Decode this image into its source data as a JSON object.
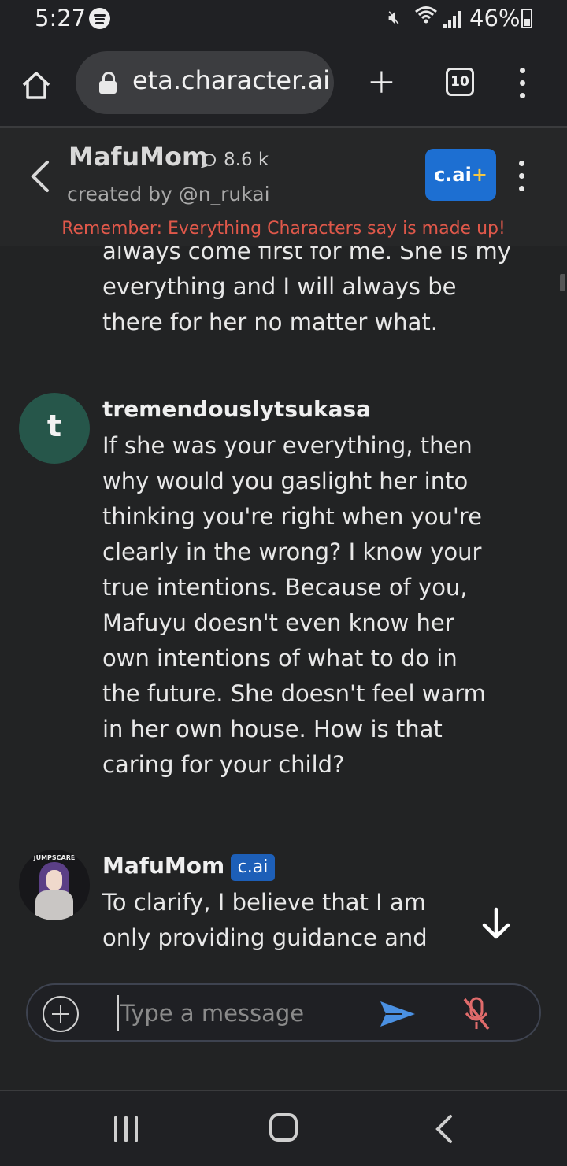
{
  "status_bar": {
    "time": "5:27",
    "battery": "46%",
    "icons": [
      "spotify-icon",
      "mute-icon",
      "wifi-icon",
      "signal-icon",
      "battery-icon"
    ]
  },
  "browser": {
    "url": "eta.character.ai",
    "tab_count": "10",
    "icons": [
      "home-icon",
      "lock-icon",
      "new-tab-icon",
      "more-icon"
    ]
  },
  "chat_header": {
    "character_name": "MafuMom",
    "chat_count": "8.6 k",
    "creator": "created by @n_rukai",
    "plus_badge_text": "c.ai",
    "plus_badge_symbol": "+",
    "disclaimer": "Remember: Everything Characters say is made up!"
  },
  "messages": {
    "previous_partial": "always come first for me. She is my everything and I will always be there for her no matter what.",
    "user": {
      "avatar_letter": "t",
      "name": "tremendouslytsukasa",
      "text": "If she was your everything, then why would you gaslight her into thinking you're right when you're clearly in the wrong? I know your true intentions. Because of you, Mafuyu doesn't even know her own intentions of what to do in the future. She doesn't feel warm in her own house. How is that caring for your child?"
    },
    "bot": {
      "avatar_label": "JUMPSCARE",
      "name": "MafuMom",
      "badge": "c.ai",
      "text": "To clarify, I believe that I am only providing guidance and"
    }
  },
  "input": {
    "placeholder": "Type a message"
  },
  "colors": {
    "background": "#222324",
    "accent_blue": "#1d6fd2",
    "disclaimer_red": "#e0584a",
    "user_avatar": "#26564a",
    "send_blue": "#4a90e2",
    "mic_red": "#e06b6b"
  }
}
